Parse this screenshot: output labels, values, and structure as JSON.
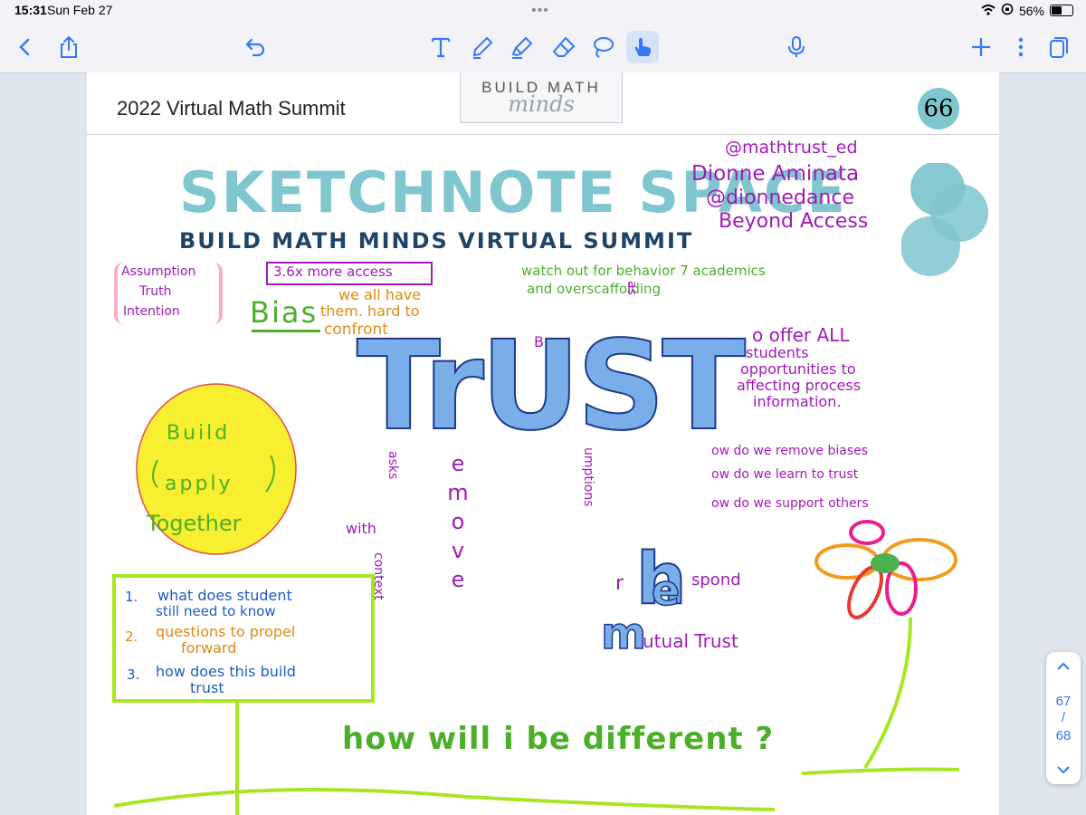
{
  "status_bar": {
    "time": "15:31",
    "date": "Sun Feb 27",
    "dots": "•••",
    "battery": "56%",
    "battery_level": 0.56
  },
  "toolbar": {
    "left": [
      "back-icon",
      "share-icon"
    ],
    "center": [
      "undo-icon",
      "text-tool-icon",
      "pen-icon",
      "highlighter-icon",
      "eraser-icon",
      "lasso-icon",
      "hand-pointer-icon"
    ],
    "right": [
      "microphone-icon",
      "add-page-icon",
      "more-icon",
      "pages-icon"
    ],
    "accent": "#3478f6"
  },
  "document": {
    "header_title": "2022 Virtual Math Summit",
    "logo_line1": "BUILD MATH",
    "logo_line2": "minds",
    "badge": "66",
    "main_title": "SKETCHNOTE SPACE",
    "subtitle": "BUILD MATH MINDS VIRTUAL SUMMIT",
    "colors": {
      "teal": "#7fc6cf",
      "navy": "#1f4466",
      "trust_blue": "#7aaee8"
    }
  },
  "sketch": {
    "credits": [
      "@mathtrust_ed",
      "Dionne Aminata",
      "@dionnedance",
      "Beyond Access"
    ],
    "assumption_box": [
      "Assumption",
      "Truth",
      "Intention"
    ],
    "more_access": "3.6x more access",
    "bias_word": "Bias",
    "bias_note": [
      "we all have",
      "them. hard to",
      "confront"
    ],
    "watch_out": [
      "watch out for  behavior 7 academics",
      "and overscaffolding"
    ],
    "trust_word": "TrUST",
    "trust_side_text": [
      "o offer ALL",
      "students",
      "opportunities to",
      "affecting process",
      "information."
    ],
    "them_letters": [
      "h",
      "e",
      "m"
    ],
    "how_questions": [
      "ow do we remove biases",
      "ow do we learn to trust",
      "ow do we support others"
    ],
    "respond": "spond",
    "r_letter": "r",
    "mutual_trust": "utual Trust",
    "with_text": "with",
    "b_letter": "B",
    "verticals": {
      "as": "as",
      "remove": "emove",
      "umptions": "umptions",
      "asks": "asks",
      "context": "context"
    },
    "sun": [
      "Build",
      "apply",
      "Together"
    ],
    "checklist": [
      {
        "num": "1.",
        "text": "what does student",
        "text2": "still need to know"
      },
      {
        "num": "2.",
        "text": "questions to propel",
        "text2": "forward"
      },
      {
        "num": "3.",
        "text": "how does this build",
        "text2": "trust"
      }
    ],
    "bottom_question": "how will i be different ?"
  },
  "pager": {
    "current": "67",
    "separator": "/",
    "total": "68"
  }
}
